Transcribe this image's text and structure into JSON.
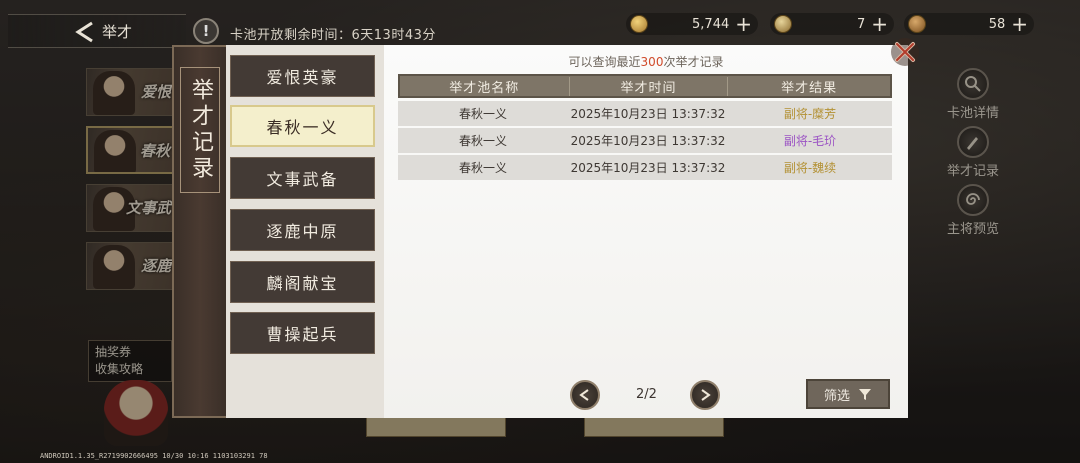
{
  "header": {
    "back_label": "举才",
    "notice_text": "卡池开放剩余时间：6天13时43分",
    "currencies": [
      {
        "icon": "gold-coin-icon",
        "value": "5,744"
      },
      {
        "icon": "jade-icon",
        "value": "7"
      },
      {
        "icon": "ticket-icon",
        "value": "58"
      }
    ]
  },
  "banners": [
    {
      "label": "爱恨"
    },
    {
      "label": "春秋"
    },
    {
      "label": "文事武"
    },
    {
      "label": "逐鹿"
    }
  ],
  "voucher": {
    "line1": "抽奖券",
    "line2": "收集攻略"
  },
  "side_actions": [
    {
      "label": "卡池详情",
      "icon": "magnifier-icon"
    },
    {
      "label": "举才记录",
      "icon": "brush-icon"
    },
    {
      "label": "主将预览",
      "icon": "spiral-icon"
    }
  ],
  "panel": {
    "title": "举才记录",
    "pools": [
      {
        "label": "爱恨英豪",
        "selected": false
      },
      {
        "label": "春秋一义",
        "selected": true
      },
      {
        "label": "文事武备",
        "selected": false
      },
      {
        "label": "逐鹿中原",
        "selected": false
      },
      {
        "label": "麟阁献宝",
        "selected": false
      },
      {
        "label": "曹操起兵",
        "selected": false
      }
    ],
    "hint_prefix": "可以查询最近",
    "hint_count": "300",
    "hint_suffix": "次举才记录",
    "columns": [
      "举才池名称",
      "举才时间",
      "举才结果"
    ],
    "rows": [
      {
        "pool": "春秋一义",
        "time": "2025年10月23日 13:37:32",
        "result": "副将-糜芳",
        "color": "#b39134"
      },
      {
        "pool": "春秋一义",
        "time": "2025年10月23日 13:37:32",
        "result": "副将-毛玠",
        "color": "#9b53c4"
      },
      {
        "pool": "春秋一义",
        "time": "2025年10月23日 13:37:32",
        "result": "副将-魏续",
        "color": "#b39134"
      }
    ],
    "page": "2/2",
    "filter_label": "筛选"
  },
  "watermark": "ANDROID1.1.35_R2719902666495 10/30 10:16 1103103291 78"
}
